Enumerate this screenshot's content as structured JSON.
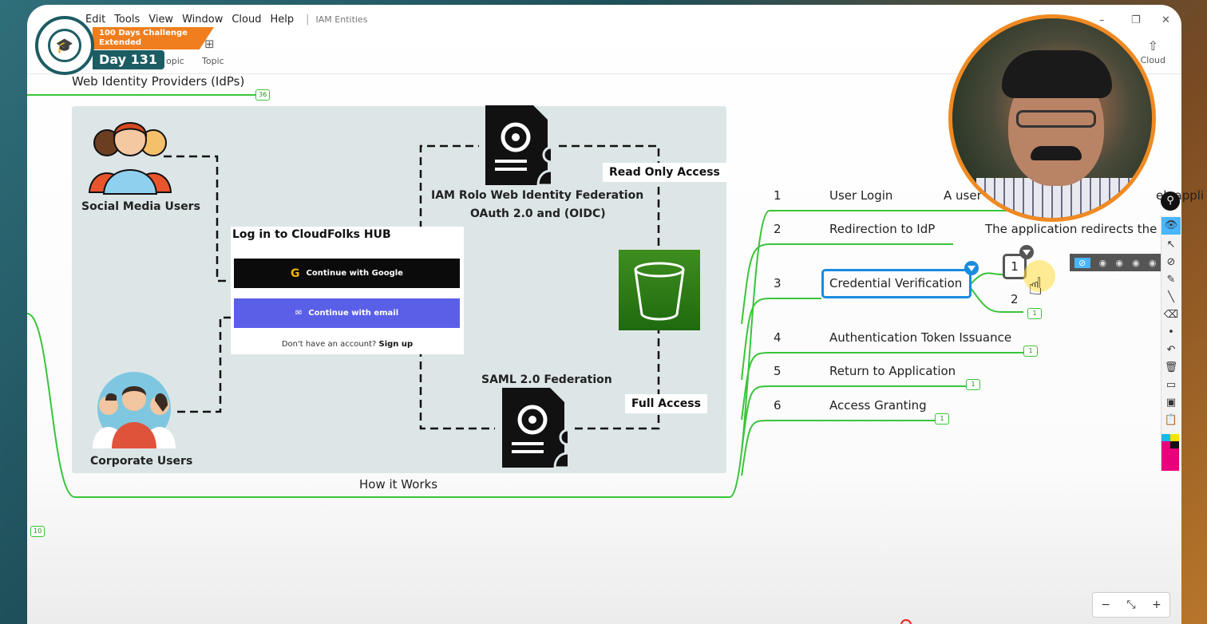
{
  "menu": {
    "items": [
      "Edit",
      "Tools",
      "View",
      "Window",
      "Cloud",
      "Help"
    ],
    "document_title": "IAM Entities"
  },
  "toolbar": {
    "btn_subtopic": "opic",
    "btn_topic": "Topic",
    "btn_share": "Cloud"
  },
  "badge": {
    "challenge_line1": "100 Days Challenge",
    "challenge_line2": "Extended",
    "day": "Day 131"
  },
  "mindmap": {
    "topic_web": "Web Identity Providers (IdPs)",
    "topic_web_count": "36",
    "topic_how": "How it Works",
    "left_count": "10"
  },
  "diagram": {
    "social_label": "Social Media Users",
    "corporate_label": "Corporate Users",
    "iam_label_line1": "IAM Rolo Web Identity Federation",
    "iam_label_line2": "OAuth 2.0 and (OIDC)",
    "saml_label": "SAML 2.0 Federation",
    "read_only": "Read Only Access",
    "full_access": "Full Access",
    "login": {
      "title": "Log in to CloudFolks HUB",
      "google": "Continue with Google",
      "email": "Continue with email",
      "signup_prefix": "Don't have an account?",
      "signup_link": "Sign up"
    }
  },
  "steps": [
    {
      "num": "1",
      "label": "User Login",
      "desc": "A user",
      "desc_tail": "eb appli",
      "count": ""
    },
    {
      "num": "2",
      "label": "Redirection to IdP",
      "desc": "The application redirects the",
      "desc_tail": "",
      "count": ""
    },
    {
      "num": "3",
      "label": "Credential Verification",
      "desc": "",
      "desc_tail": "",
      "count": ""
    },
    {
      "num": "4",
      "label": "Authentication Token Issuance",
      "desc": "",
      "desc_tail": "",
      "count": "1"
    },
    {
      "num": "5",
      "label": "Return to Application",
      "desc": "",
      "desc_tail": "",
      "count": "1"
    },
    {
      "num": "6",
      "label": "Access Granting",
      "desc": "",
      "desc_tail": "",
      "count": "1"
    }
  ],
  "subtopics": {
    "one": "1",
    "two": "2",
    "count": "1"
  },
  "zoom": {
    "minus": "−",
    "fit": "⤡",
    "plus": "+"
  },
  "colors": {
    "accent": "#1a8ce0",
    "branch": "#3ac43a",
    "badge_orange": "#f07e1e",
    "badge_teal": "#1c5c63"
  }
}
